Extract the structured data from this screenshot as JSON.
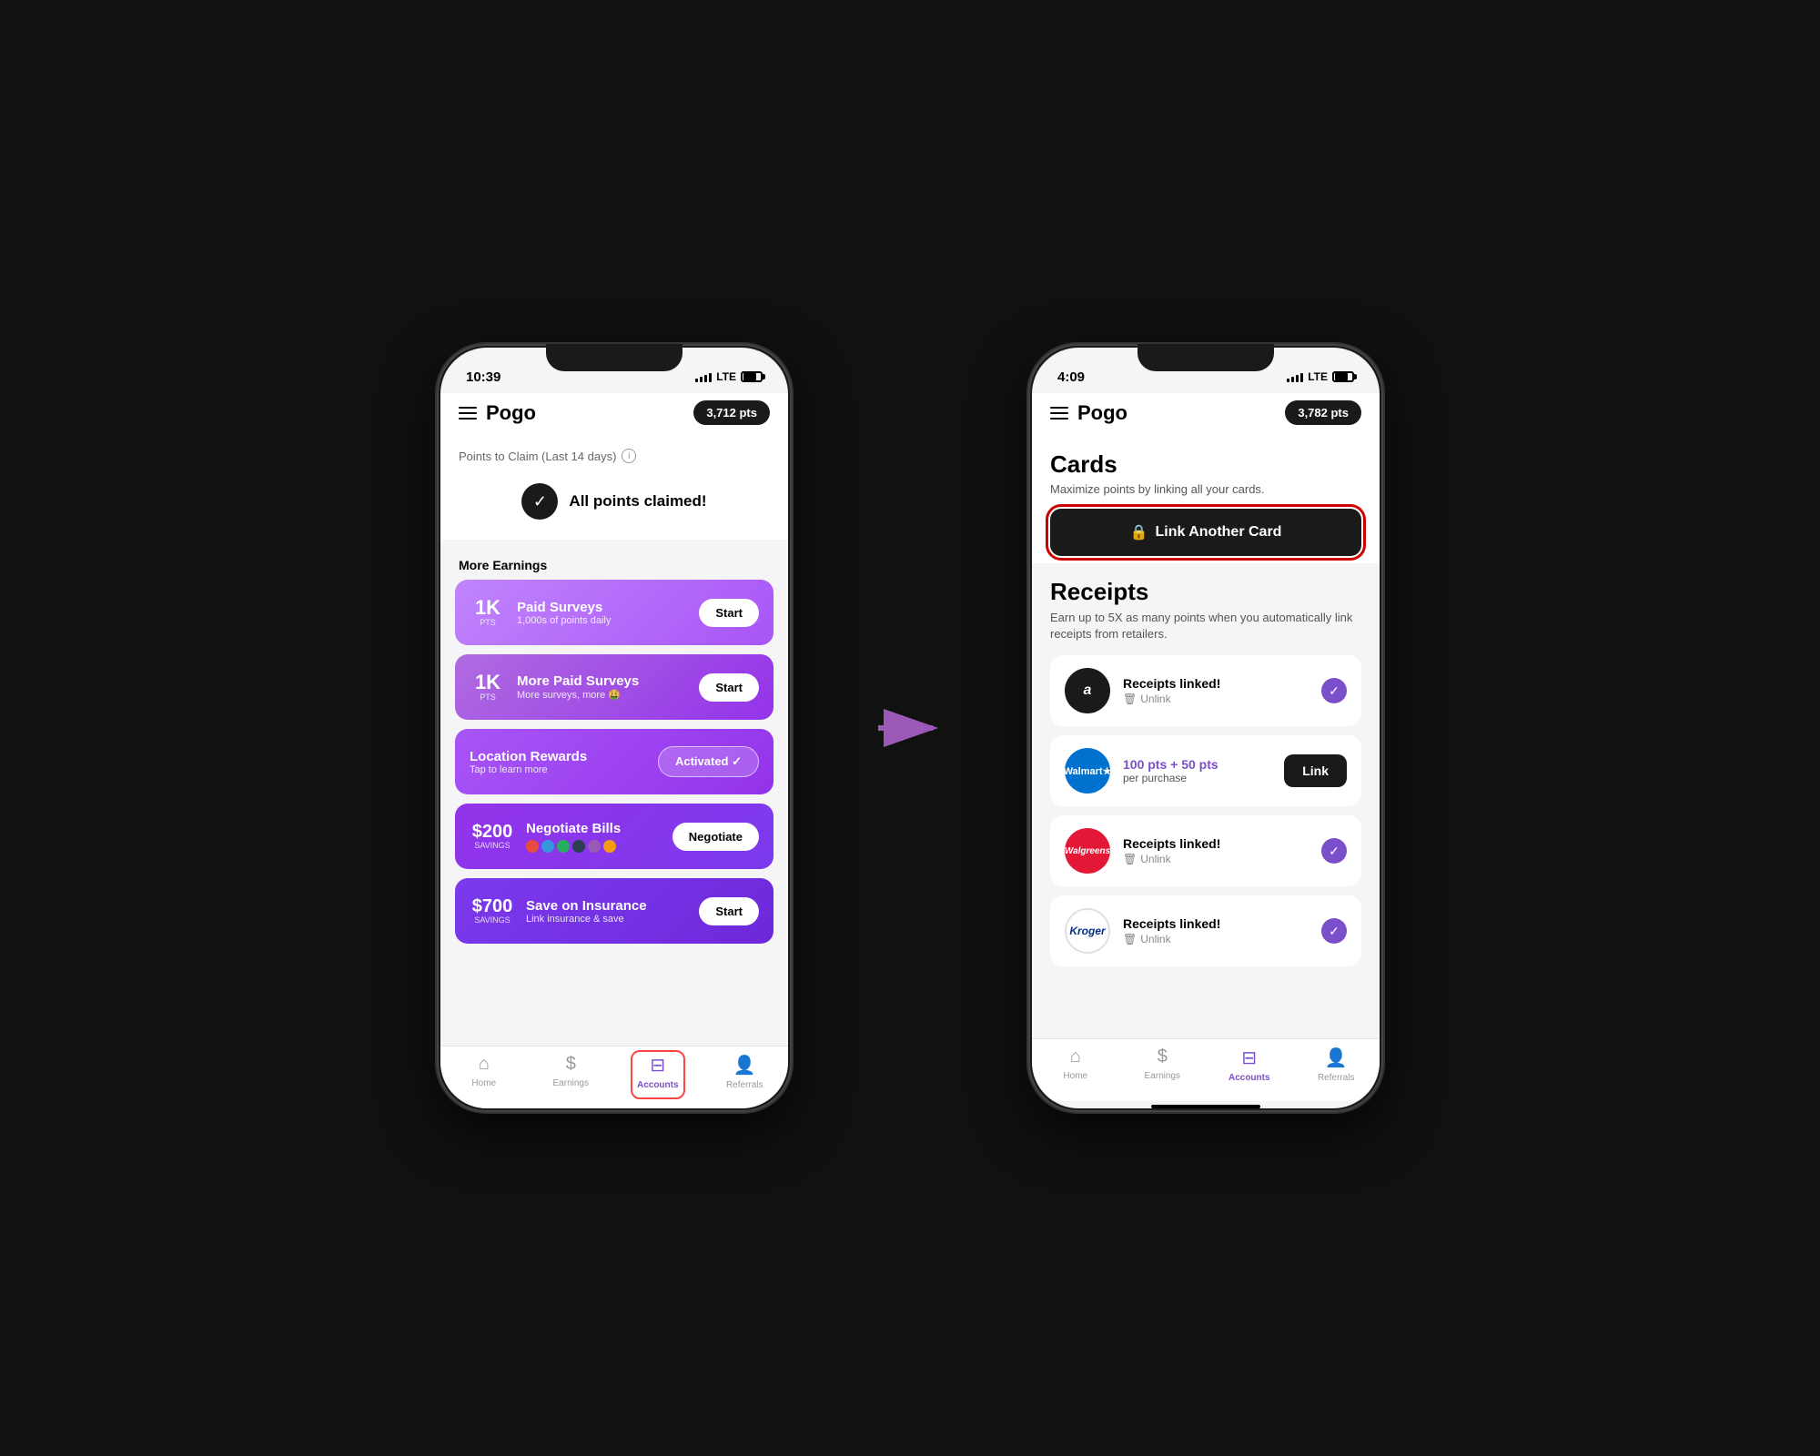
{
  "phone1": {
    "status": {
      "time": "10:39",
      "signal": "LTE"
    },
    "header": {
      "logo": "Pogo",
      "points": "3,712 pts"
    },
    "points_section": {
      "label": "Points to Claim (Last 14 days)",
      "all_claimed": "All points claimed!"
    },
    "more_earnings": {
      "label": "More Earnings",
      "items": [
        {
          "amount": "1K",
          "unit": "PTS",
          "title": "Paid Surveys",
          "subtitle": "1,000s of points daily",
          "button": "Start"
        },
        {
          "amount": "1K",
          "unit": "PTS",
          "title": "More Paid Surveys",
          "subtitle": "More surveys, more 🤑",
          "button": "Start"
        },
        {
          "amount": "",
          "unit": "",
          "title": "Location Rewards",
          "subtitle": "Tap to learn more",
          "button": "Activated ✓"
        },
        {
          "amount": "$200",
          "unit": "SAVINGS",
          "title": "Negotiate Bills",
          "subtitle": "",
          "button": "Negotiate"
        },
        {
          "amount": "$700",
          "unit": "SAVINGS",
          "title": "Save on Insurance",
          "subtitle": "Link insurance & save",
          "button": "Start"
        }
      ]
    },
    "nav": {
      "items": [
        {
          "label": "Home",
          "icon": "🏠"
        },
        {
          "label": "Earnings",
          "icon": "$"
        },
        {
          "label": "Accounts",
          "icon": "💳"
        },
        {
          "label": "Referrals",
          "icon": "👤"
        }
      ],
      "active": "Accounts",
      "highlighted": "Accounts"
    }
  },
  "phone2": {
    "status": {
      "time": "4:09",
      "signal": "LTE"
    },
    "header": {
      "logo": "Pogo",
      "points": "3,782 pts"
    },
    "cards": {
      "title": "Cards",
      "subtitle": "Maximize points by linking all your cards.",
      "link_button": "Link Another Card"
    },
    "receipts": {
      "title": "Receipts",
      "subtitle": "Earn up to 5X as many points when you automatically link receipts from retailers.",
      "items": [
        {
          "name": "Amazon",
          "color": "amazon",
          "status": "Receipts linked!",
          "linked": true,
          "points": ""
        },
        {
          "name": "Walmart",
          "color": "walmart",
          "status": "100 pts + 50 pts\nper purchase",
          "linked": false,
          "points": "100 pts + 50 pts"
        },
        {
          "name": "Walgreens",
          "color": "walgreens",
          "status": "Receipts linked!",
          "linked": true,
          "points": ""
        },
        {
          "name": "Kroger",
          "color": "kroger",
          "status": "Receipts linked!",
          "linked": true,
          "points": ""
        }
      ]
    },
    "nav": {
      "items": [
        {
          "label": "Home",
          "icon": "🏠"
        },
        {
          "label": "Earnings",
          "icon": "$"
        },
        {
          "label": "Accounts",
          "icon": "💳"
        },
        {
          "label": "Referrals",
          "icon": "👤"
        }
      ],
      "active": "Accounts"
    }
  },
  "arrow": "→",
  "unlink_label": "Unlink",
  "link_label": "Link"
}
